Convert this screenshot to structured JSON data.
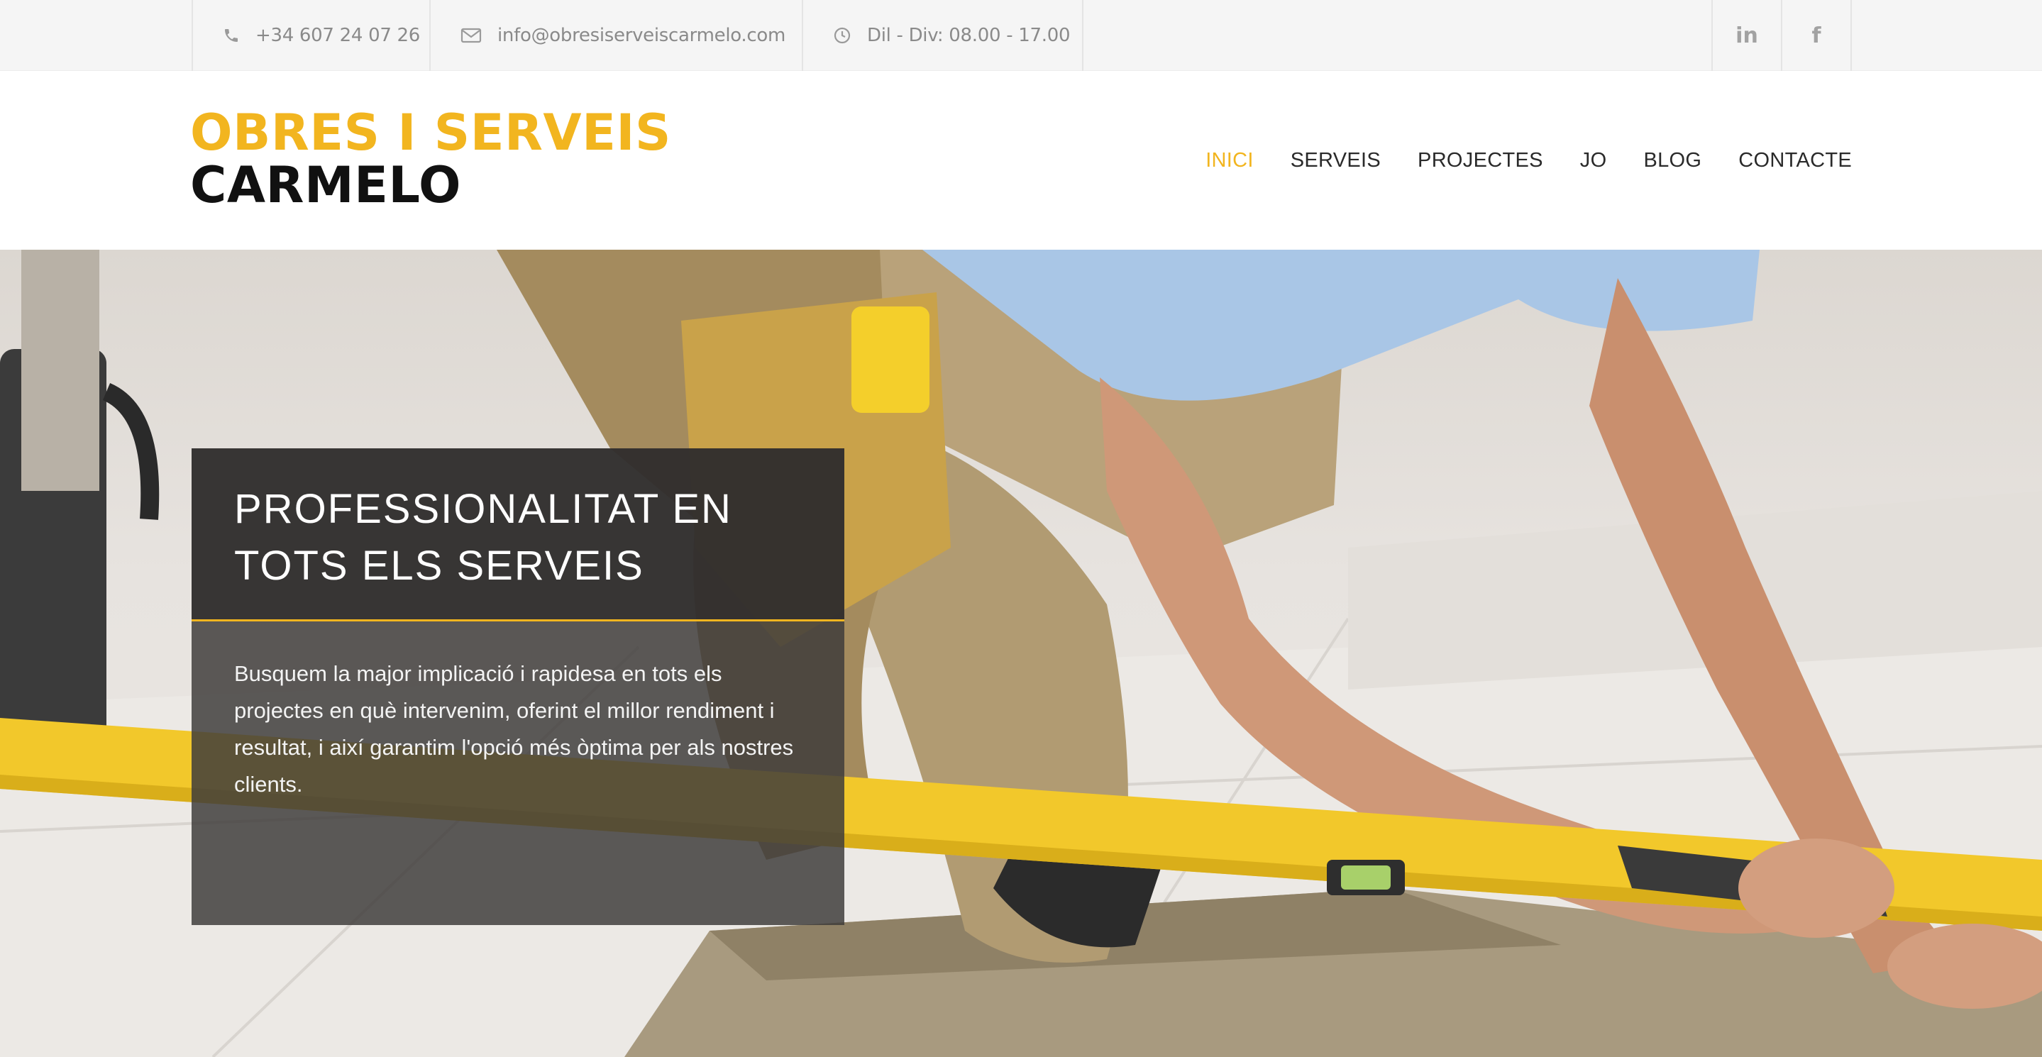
{
  "topbar": {
    "phone": {
      "icon": "phone-icon",
      "text": "+34 607 24 07 26"
    },
    "email": {
      "icon": "envelope-icon",
      "text": "info@obresiserveiscarmelo.com"
    },
    "hours": {
      "icon": "clock-icon",
      "text": "Dil - Div: 08.00 - 17.00"
    },
    "social": [
      {
        "icon": "linkedin-icon",
        "glyph": "in"
      },
      {
        "icon": "facebook-icon",
        "glyph": "f"
      }
    ]
  },
  "header": {
    "logo_line1": "OBRES I SERVEIS",
    "logo_line2": "CARMELO",
    "nav": [
      {
        "label": "INICI",
        "active": true
      },
      {
        "label": "SERVEIS",
        "active": false
      },
      {
        "label": "PROJECTES",
        "active": false
      },
      {
        "label": "JO",
        "active": false
      },
      {
        "label": "BLOG",
        "active": false
      },
      {
        "label": "CONTACTE",
        "active": false
      }
    ]
  },
  "hero": {
    "title": "PROFESSIONALITAT EN TOTS ELS SERVEIS",
    "text": "Busquem la major implicació i rapidesa en tots els projectes en què intervenim, oferint el millor rendiment i resultat, i així garantim l'opció més òptima per als nostres clients."
  },
  "colors": {
    "accent": "#f2b51f",
    "topbar_bg": "#f5f5f5",
    "card_bg": "#302e2d"
  }
}
